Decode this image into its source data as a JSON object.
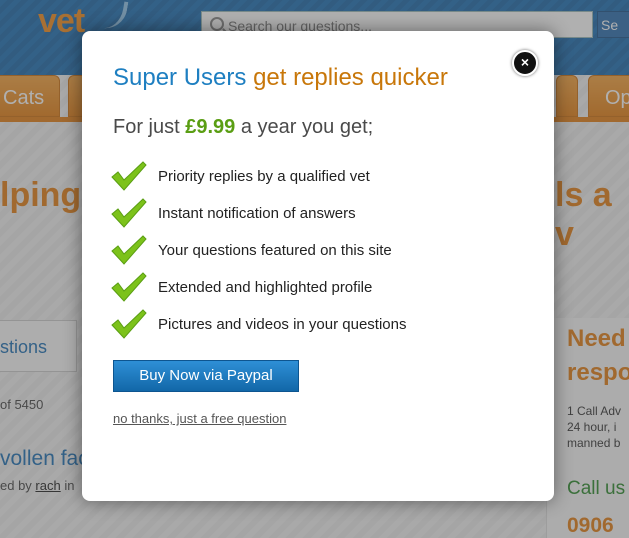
{
  "background_page": {
    "logo": "vet",
    "search_placeholder": "Search our questions...",
    "search_button": "Se",
    "nav_tabs": [
      "Cats",
      "Op"
    ],
    "heading_left": "lping",
    "heading_right": "ls a v",
    "questions_tab": "stions",
    "count_text": "of 5450",
    "question_title": "vollen fac",
    "byline_prefix": "ed by ",
    "byline_user": "rach",
    "byline_suffix": " in",
    "sidebar_heading": "Need respo",
    "sidebar_text_1": "1 Call Adv",
    "sidebar_text_2": "24 hour, i",
    "sidebar_text_3": "manned b",
    "call_us": "Call us",
    "phone": "0906"
  },
  "modal": {
    "title_part1": "Super Users",
    "title_part2": "get replies quicker",
    "subtitle_prefix": "For just",
    "price": "£9.99",
    "subtitle_suffix": "a year you get;",
    "features": [
      "Priority replies by a qualified vet",
      "Instant notification of answers",
      "Your questions featured on this site",
      "Extended and highlighted profile",
      "Pictures and videos in your questions"
    ],
    "buy_button": "Buy Now via Paypal",
    "decline_link": "no thanks, just a free question",
    "close_label": "×"
  },
  "colors": {
    "title_blue": "#1e7fc1",
    "title_orange": "#c8770a",
    "price_green": "#5a9e13",
    "check_green": "#7cc21a",
    "button_blue": "#1b76bd"
  },
  "icons": {
    "feature_check": "checkmark-icon",
    "close": "close-icon",
    "search": "search-icon"
  }
}
